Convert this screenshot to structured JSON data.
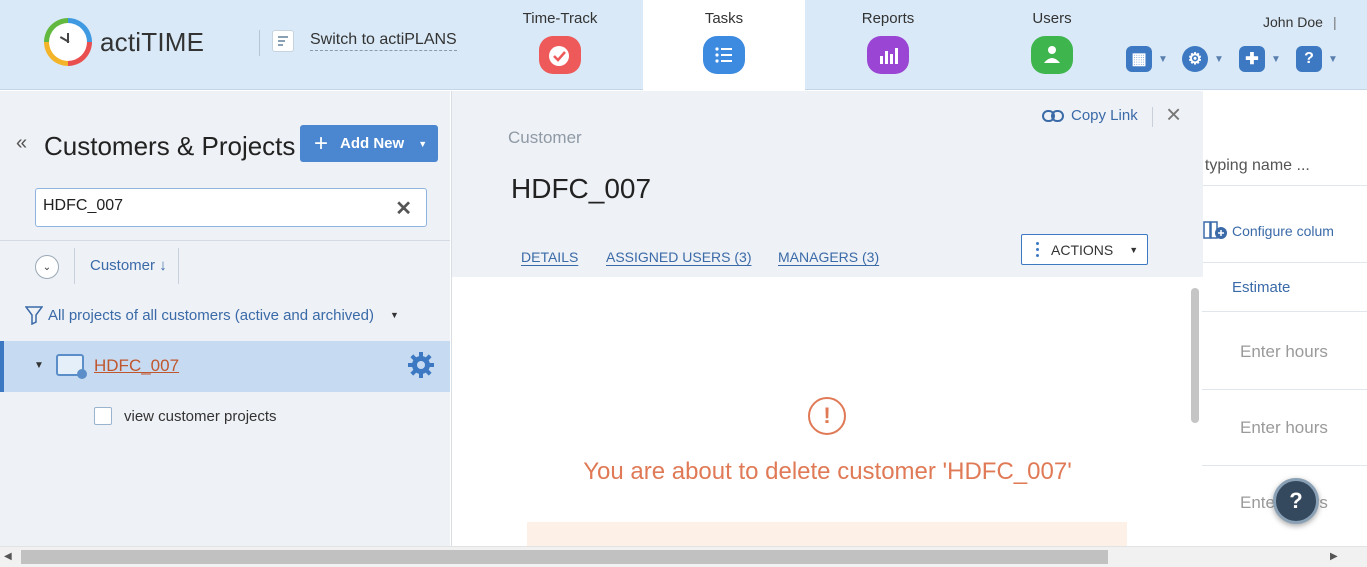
{
  "app": {
    "logo_text": "actiTIME"
  },
  "switch": {
    "label": "Switch to actiPLANS"
  },
  "nav": [
    {
      "label": "Time-Track",
      "icon": "checkmark-icon",
      "color": "#ee5a5a"
    },
    {
      "label": "Tasks",
      "icon": "list-icon",
      "color": "#3d8be0"
    },
    {
      "label": "Reports",
      "icon": "bar-chart-icon",
      "color": "#9b45d4"
    },
    {
      "label": "Users",
      "icon": "user-icon",
      "color": "#3fb54d"
    }
  ],
  "user": {
    "name": "John Doe",
    "separator": "|"
  },
  "left": {
    "title": "Customers & Projects",
    "add_new_label": "Add New",
    "search_value": "HDFC_007",
    "column_customer": "Customer",
    "filter_label": "All projects of all customers (active and archived)",
    "customer_name": "HDFC_007",
    "view_projects": "view customer projects"
  },
  "modal": {
    "type_label": "Customer",
    "title": "HDFC_007",
    "copy_link": "Copy Link",
    "tabs": [
      "DETAILS",
      "ASSIGNED USERS (3)",
      "MANAGERS (3)"
    ],
    "actions_label": "ACTIONS",
    "warning": "You are about to delete customer 'HDFC_007'"
  },
  "background": {
    "search_placeholder": "t typing name ...",
    "configure_columns": "Configure colum",
    "estimate_header": "Estimate",
    "hours_placeholder": "Enter hours"
  },
  "colors": {
    "accent": "#3d78c2",
    "warning": "#e07a56",
    "selected_row": "#c6dbf2"
  }
}
